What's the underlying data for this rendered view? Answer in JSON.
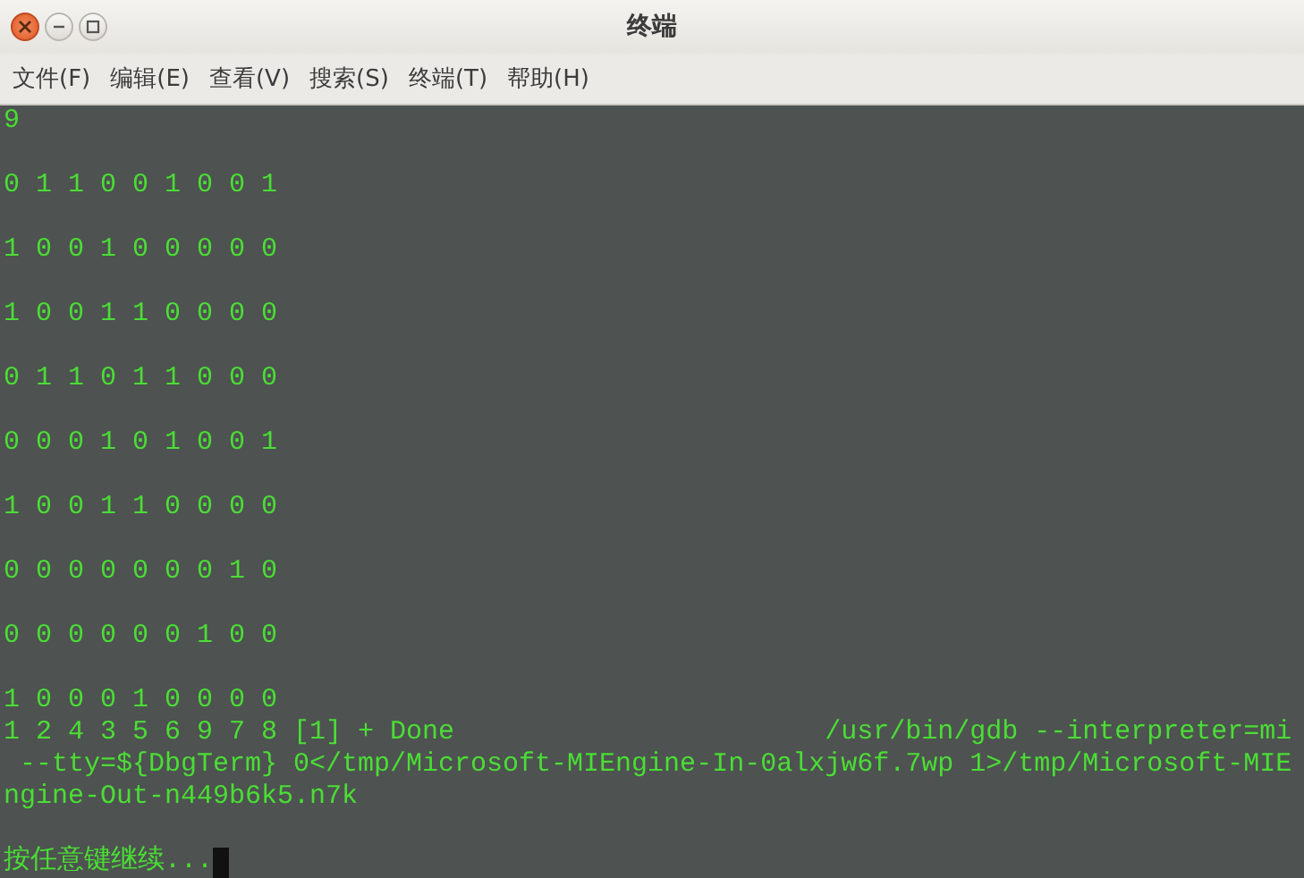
{
  "window": {
    "title": "终端"
  },
  "menu": [
    "文件(F)",
    "编辑(E)",
    "查看(V)",
    "搜索(S)",
    "终端(T)",
    "帮助(H)"
  ],
  "terminal": {
    "blocks": [
      [
        "9"
      ],
      [
        "0 1 1 0 0 1 0 0 1"
      ],
      [
        "1 0 0 1 0 0 0 0 0"
      ],
      [
        "1 0 0 1 1 0 0 0 0"
      ],
      [
        "0 1 1 0 1 1 0 0 0"
      ],
      [
        "0 0 0 1 0 1 0 0 1"
      ],
      [
        "1 0 0 1 1 0 0 0 0"
      ],
      [
        "0 0 0 0 0 0 0 1 0"
      ],
      [
        "0 0 0 0 0 0 1 0 0"
      ],
      [
        "1 0 0 0 1 0 0 0 0",
        "1 2 4 3 5 6 9 7 8 [1] + Done                       /usr/bin/gdb --interpreter=mi",
        " --tty=${DbgTerm} 0</tmp/Microsoft-MIEngine-In-0alxjw6f.7wp 1>/tmp/Microsoft-MIE",
        "ngine-Out-n449b6k5.n7k"
      ],
      [
        "按任意键继续..."
      ]
    ]
  }
}
